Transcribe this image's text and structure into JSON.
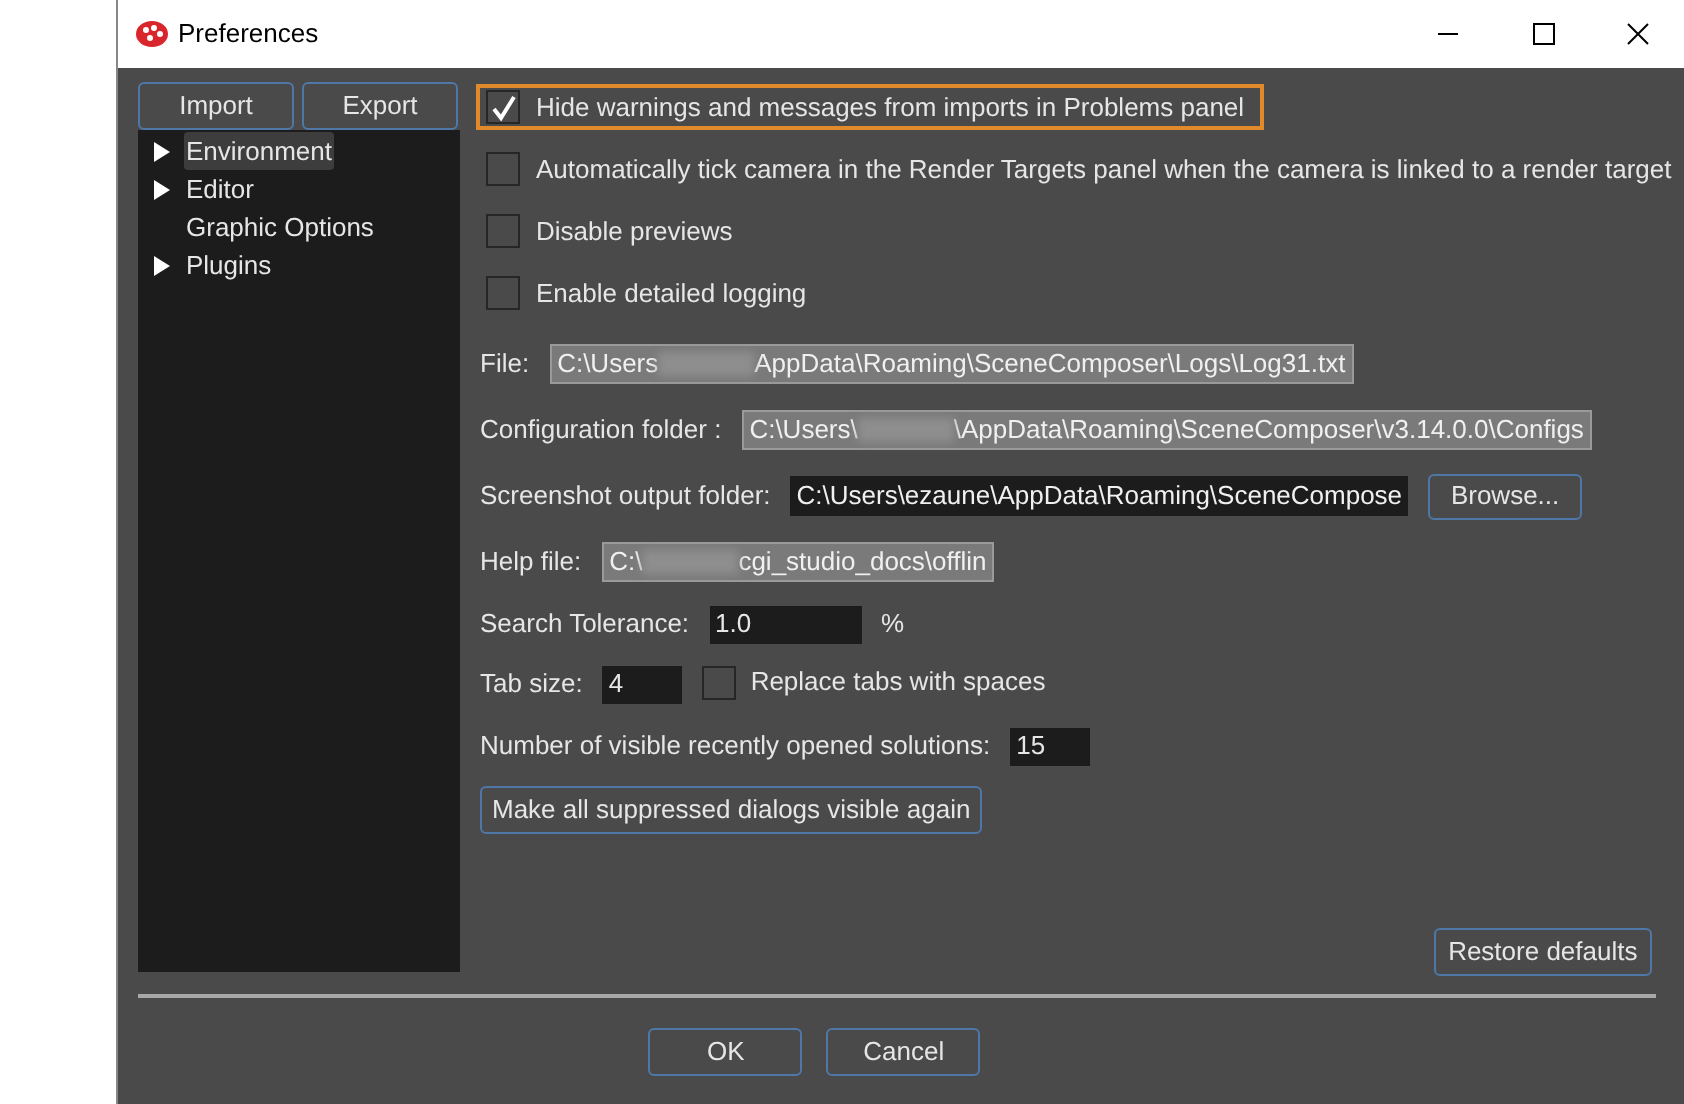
{
  "window": {
    "title": "Preferences"
  },
  "sidebar": {
    "buttons": [
      "Import",
      "Export"
    ],
    "items": [
      {
        "label": "Environment",
        "selected": true,
        "has_children": true
      },
      {
        "label": "Editor",
        "selected": false,
        "has_children": true
      },
      {
        "label": "Graphic Options",
        "selected": false,
        "has_children": false
      },
      {
        "label": "Plugins",
        "selected": false,
        "has_children": true
      }
    ]
  },
  "checkboxes": [
    {
      "label": "Hide warnings and messages from imports in Problems panel",
      "checked": true,
      "focused": true
    },
    {
      "label": "Automatically tick camera in the Render Targets panel when the camera is linked to a render target",
      "checked": false,
      "focused": false
    },
    {
      "label": "Disable previews",
      "checked": false,
      "focused": false
    },
    {
      "label": "Enable detailed logging",
      "checked": false,
      "focused": false
    }
  ],
  "paths": [
    {
      "label": "File:",
      "value_start": "C:\\Users",
      "value_end": "AppData\\Roaming\\SceneComposer\\Logs\\Log31.txt",
      "redacted": true,
      "editable": false
    },
    {
      "label": "Configuration folder :",
      "value_start": "C:\\Users\\",
      "value_end": "\\AppData\\Roaming\\SceneComposer\\v3.14.0.0\\Configs",
      "redacted": true,
      "editable": false
    },
    {
      "label": "Screenshot output folder:",
      "value_start": "C:\\Users\\ezaune\\AppData\\Roaming\\SceneCompose",
      "redacted": false,
      "editable": true,
      "button": "Browse..."
    },
    {
      "label": "Help file:",
      "value_start": "C:\\",
      "value_end": "cgi_studio_docs\\offlin",
      "redacted": true,
      "editable": false
    }
  ],
  "search_tolerance": {
    "label": "Search Tolerance:",
    "value": "1.0",
    "unit": "%"
  },
  "tab_size": {
    "label": "Tab size:",
    "value": "4",
    "replace_label": "Replace tabs with spaces",
    "replace_checked": false
  },
  "recent": {
    "label": "Number of visible recently opened solutions:",
    "value": "15"
  },
  "suppressed_button": "Make all suppressed dialogs visible again",
  "restore_button": "Restore defaults",
  "dialog_buttons": [
    "OK",
    "Cancel"
  ]
}
